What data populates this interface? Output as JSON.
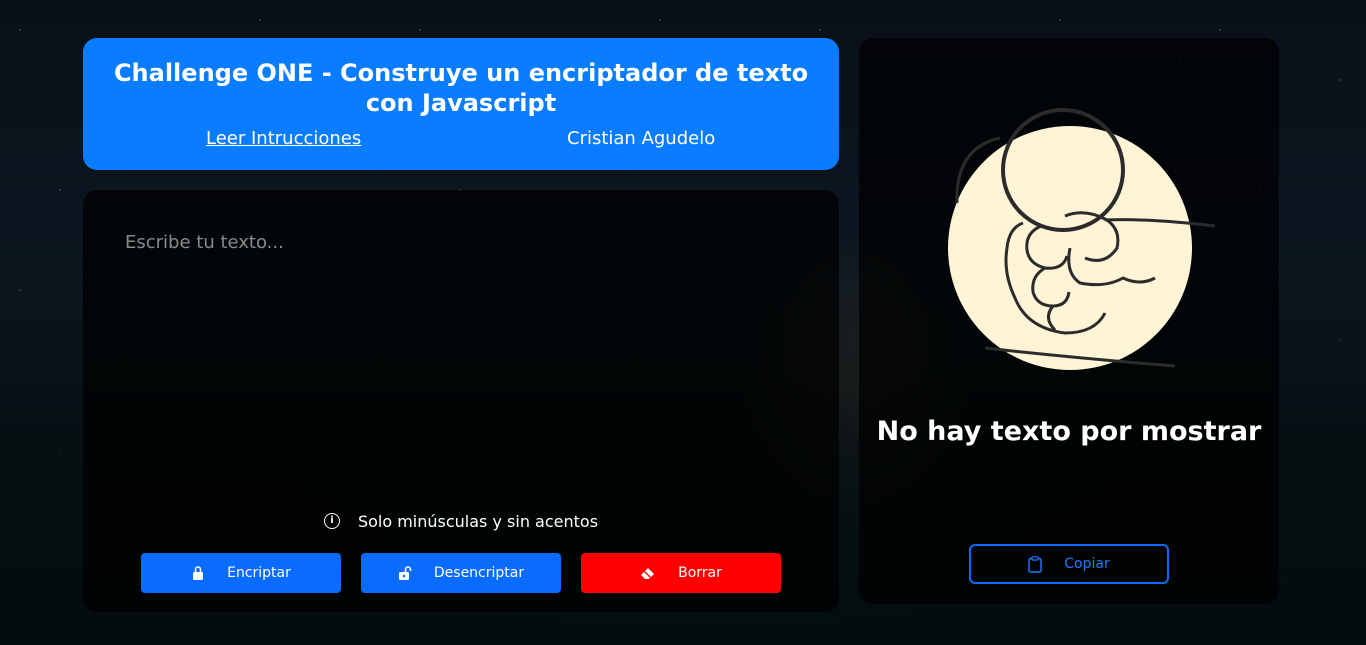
{
  "header": {
    "title": "Challenge ONE - Construye un encriptador de texto con Javascript",
    "instructions_link": "Leer Intrucciones",
    "author": "Cristian Agudelo"
  },
  "editor": {
    "placeholder": "Escribe tu texto...",
    "value": "",
    "hint": "Solo minúsculas y sin acentos"
  },
  "actions": {
    "encrypt_label": "Encriptar",
    "decrypt_label": "Desencriptar",
    "clear_label": "Borrar"
  },
  "output": {
    "empty_message": "No hay texto por mostrar",
    "copy_label": "Copiar"
  },
  "colors": {
    "accent": "#0a7cff",
    "danger": "#ff0000",
    "illustration_fill": "#fff4d6"
  },
  "icons": {
    "encrypt": "lock-icon",
    "decrypt": "unlock-icon",
    "clear": "eraser-icon",
    "copy": "clipboard-icon",
    "hint": "info-icon"
  }
}
